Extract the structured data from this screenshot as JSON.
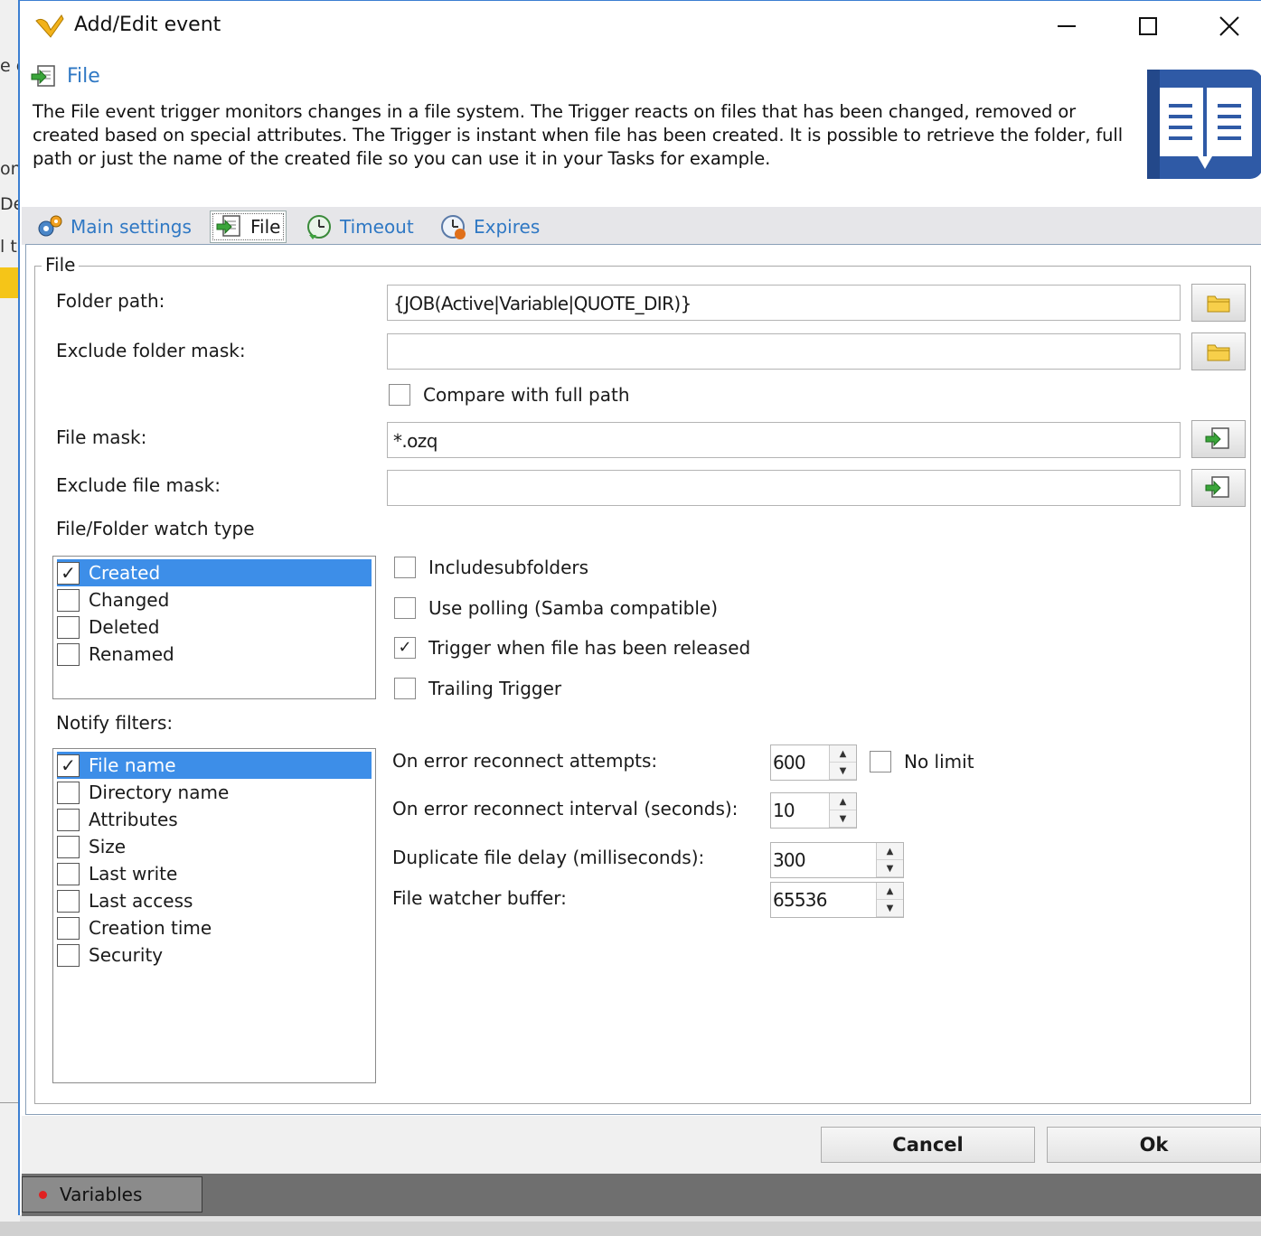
{
  "window": {
    "title": "Add/Edit event",
    "controls": [
      "minimize",
      "maximize",
      "close"
    ]
  },
  "background": {
    "fragments": [
      "e c",
      "on",
      "De",
      "l t"
    ]
  },
  "header": {
    "title": "File",
    "description": "The File event trigger monitors changes in a file system. The Trigger reacts on files that has been changed, removed or created based on special attributes. The Trigger is instant when file has been created. It is possible to retrieve the folder, full path or just the name of the created file so you can use it in your Tasks for example."
  },
  "tabs": [
    {
      "label": "Main settings",
      "icon": "gears-icon"
    },
    {
      "label": "File",
      "icon": "file-arrow-icon",
      "active": true
    },
    {
      "label": "Timeout",
      "icon": "clock-icon"
    },
    {
      "label": "Expires",
      "icon": "expires-clock-icon"
    }
  ],
  "group": {
    "legend": "File",
    "folder_path": {
      "label": "Folder path:",
      "value": "{JOB(Active|Variable|QUOTE_DIR)}"
    },
    "exclude_folder_mask": {
      "label": "Exclude folder mask:",
      "value": ""
    },
    "compare_full_path": {
      "label": "Compare with full path",
      "checked": false
    },
    "file_mask": {
      "label": "File mask:",
      "value": "*.ozq"
    },
    "exclude_file_mask": {
      "label": "Exclude file mask:",
      "value": ""
    },
    "watch_type": {
      "label": "File/Folder watch type",
      "items": [
        {
          "label": "Created",
          "checked": true,
          "selected": true
        },
        {
          "label": "Changed",
          "checked": false
        },
        {
          "label": "Deleted",
          "checked": false
        },
        {
          "label": "Renamed",
          "checked": false
        }
      ]
    },
    "options": {
      "include_subfolders": {
        "label": "Includesubfolders",
        "checked": false
      },
      "use_polling": {
        "label": "Use polling (Samba compatible)",
        "checked": false
      },
      "trigger_released": {
        "label": "Trigger when file has been released",
        "checked": true
      },
      "trailing_trigger": {
        "label": "Trailing Trigger",
        "checked": false
      }
    },
    "notify_filters": {
      "label": "Notify filters:",
      "items": [
        {
          "label": "File name",
          "checked": true,
          "selected": true
        },
        {
          "label": "Directory name",
          "checked": false
        },
        {
          "label": "Attributes",
          "checked": false
        },
        {
          "label": "Size",
          "checked": false
        },
        {
          "label": "Last write",
          "checked": false
        },
        {
          "label": "Last access",
          "checked": false
        },
        {
          "label": "Creation time",
          "checked": false
        },
        {
          "label": "Security",
          "checked": false
        }
      ]
    },
    "reconnect_attempts": {
      "label": "On error reconnect attempts:",
      "value": "600"
    },
    "no_limit": {
      "label": "No limit",
      "checked": false
    },
    "reconnect_interval": {
      "label": "On error reconnect interval (seconds):",
      "value": "10"
    },
    "duplicate_delay": {
      "label": "Duplicate file delay (milliseconds):",
      "value": "300"
    },
    "watcher_buffer": {
      "label": "File watcher buffer:",
      "value": "65536"
    }
  },
  "buttons": {
    "cancel": "Cancel",
    "ok": "Ok"
  },
  "footer": {
    "variables_tab": "Variables"
  },
  "colors": {
    "accent": "#2f78c4",
    "selection": "#3d8ee8",
    "window_border": "#3c7fd1",
    "status_dot": "#e02020"
  }
}
